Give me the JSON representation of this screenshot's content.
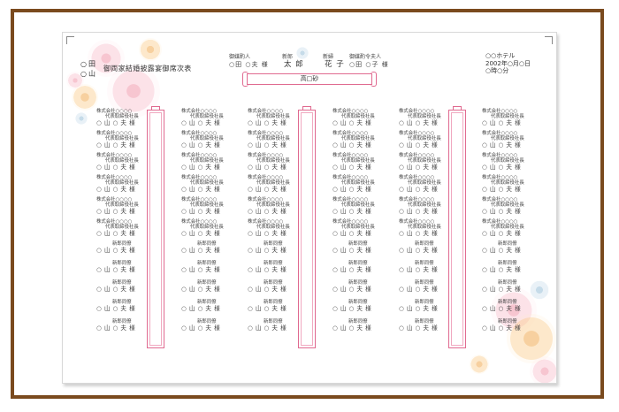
{
  "family": {
    "marks": [
      "○",
      "○"
    ],
    "names": [
      "田",
      "山"
    ]
  },
  "document_title": "御両家結婚披露宴御席次表",
  "groom_father": {
    "label": "御媒酌人",
    "name": "○田 ○夫 様"
  },
  "couple": {
    "groom_label": "新郎",
    "groom_name": "太 郎",
    "bride_label": "新婦",
    "bride_name": "花 子"
  },
  "bride_mother": {
    "label": "御媒酌令夫人",
    "name": "○田 ○子 様"
  },
  "hotel": {
    "name": "○○ホテル",
    "date": "2002年○月○日",
    "time": "○時○分"
  },
  "head_table": {
    "label": "高□砂"
  },
  "guest_templates": {
    "company": "株式会社○○○○",
    "position": "代表取締役社長",
    "friend_label": "新郎同僚",
    "guest_name": "○ 山 ○ 夫 様"
  },
  "colors": {
    "frame": "#7a4a1e",
    "table_border": "#e06a90",
    "flower_pink": "#f096aa",
    "flower_orange": "#f0aa50",
    "flower_blue": "#96bed7"
  }
}
